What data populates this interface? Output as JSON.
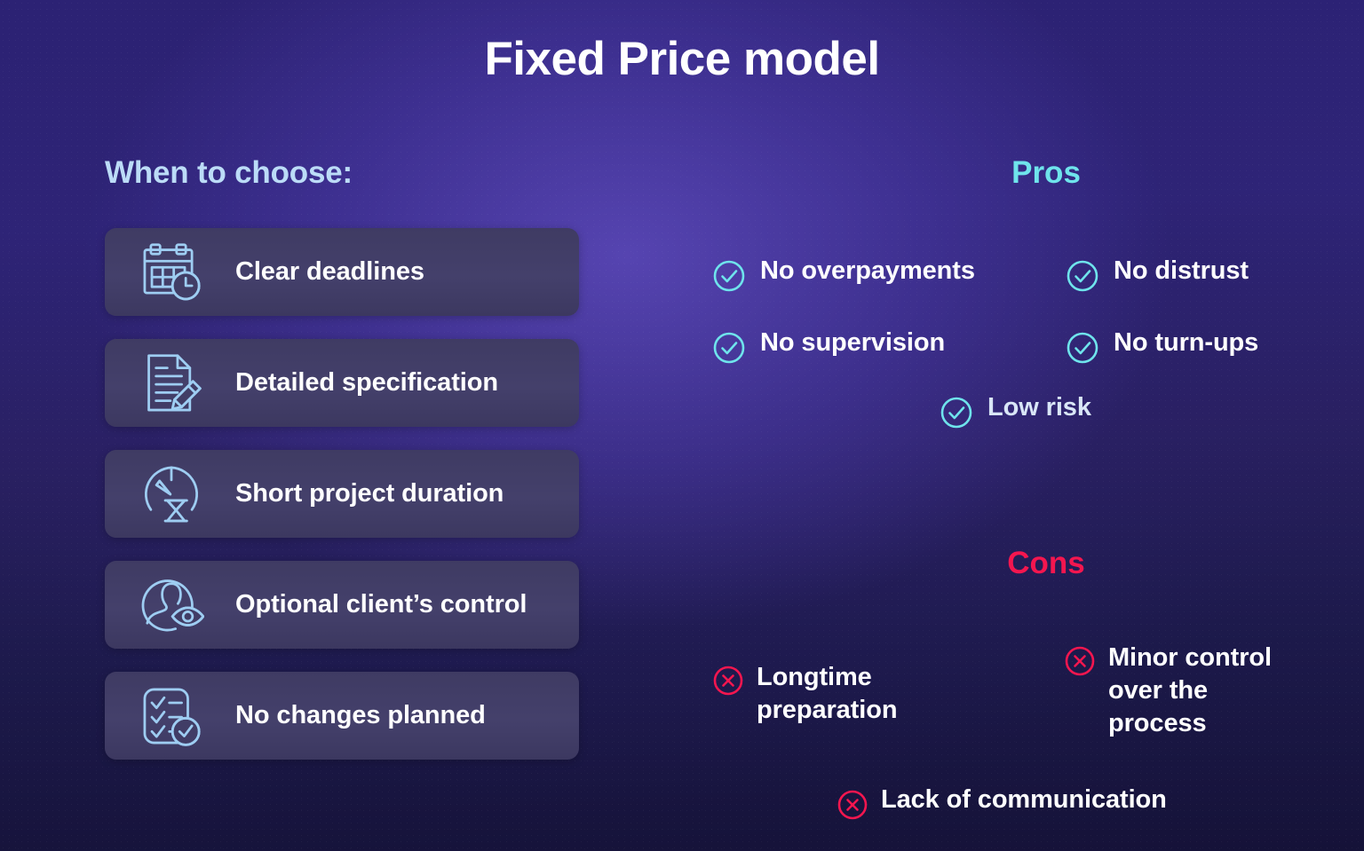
{
  "title": "Fixed Price model",
  "colors": {
    "accent_cyan": "#6fe4ec",
    "accent_red": "#f4164f",
    "icon_blue": "#9ecdf2",
    "heading_blue": "#bcdcf7",
    "card_bg": "#413d66",
    "text_white": "#ffffff",
    "background_top": "#2c2274",
    "background_bottom": "#151238"
  },
  "left": {
    "heading": "When to choose:",
    "cards": [
      {
        "label": "Clear deadlines",
        "icon": "calendar-clock-icon"
      },
      {
        "label": "Detailed specification",
        "icon": "document-pencil-icon"
      },
      {
        "label": "Short project duration",
        "icon": "gauge-hourglass-icon"
      },
      {
        "label": "Optional client’s control",
        "icon": "person-eye-icon"
      },
      {
        "label": "No changes planned",
        "icon": "checklist-icon"
      }
    ]
  },
  "pros": {
    "heading": "Pros",
    "icon": "check-circle-icon",
    "items": [
      {
        "label": "No overpayments"
      },
      {
        "label": "No distrust"
      },
      {
        "label": "No supervision"
      },
      {
        "label": "No turn-ups"
      },
      {
        "label": "Low risk"
      }
    ]
  },
  "cons": {
    "heading": "Cons",
    "icon": "x-circle-icon",
    "items": [
      {
        "label": "Longtime preparation"
      },
      {
        "label": "Minor control over the process"
      },
      {
        "label": "Lack of communication"
      }
    ]
  }
}
